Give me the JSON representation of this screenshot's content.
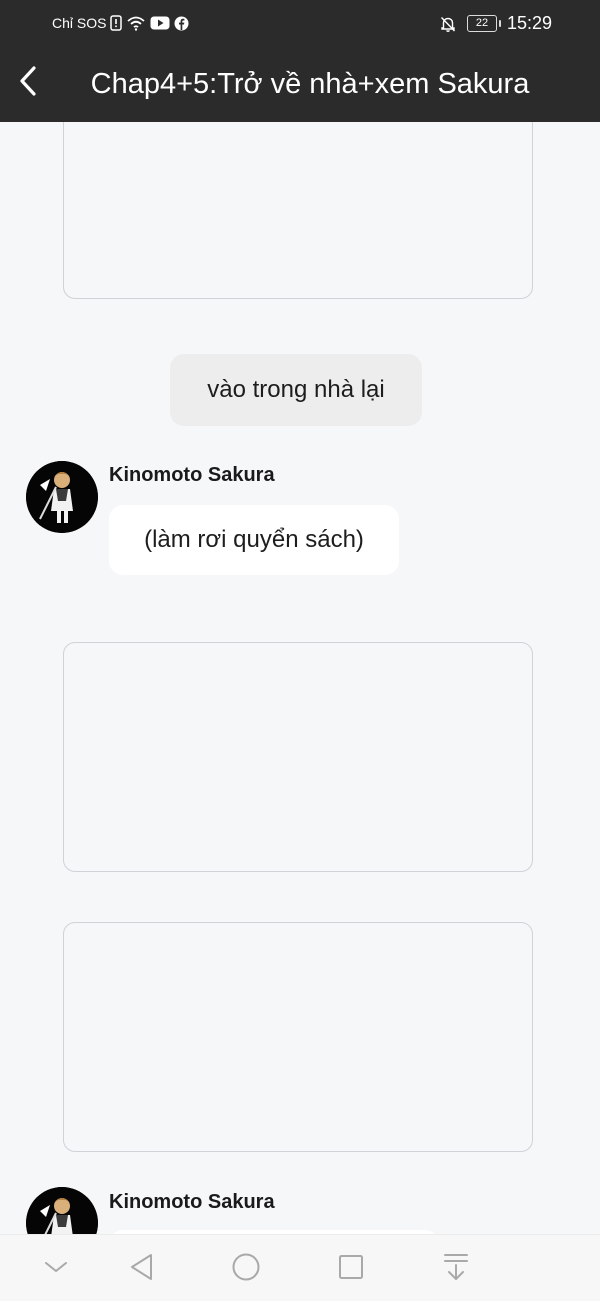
{
  "status_bar": {
    "carrier": "Chỉ SOS",
    "battery": "22",
    "time": "15:29",
    "icons": [
      "sim-alert-icon",
      "wifi-icon",
      "youtube-icon",
      "facebook-icon",
      "bell-off-icon",
      "battery-icon"
    ]
  },
  "header": {
    "title": "Chap4+5:Trở về nhà+xem Sakura",
    "back_icon": "back-chevron-icon"
  },
  "feed": {
    "narration": "vào trong nhà lại",
    "messages": [
      {
        "author": "Kinomoto Sakura",
        "text": "(làm rơi quyển sách)"
      },
      {
        "author": "Kinomoto Sakura",
        "text": ""
      }
    ]
  },
  "nav_bar": {
    "icons": [
      "collapse-chevron-icon",
      "back-triangle-icon",
      "home-circle-icon",
      "recents-square-icon",
      "notification-shade-icon"
    ]
  },
  "colors": {
    "top_bar": "#2b2b2b",
    "background": "#f6f7f9",
    "narration_bubble": "#ededee",
    "message_bubble": "#ffffff",
    "card_border": "#cfd2d6"
  }
}
